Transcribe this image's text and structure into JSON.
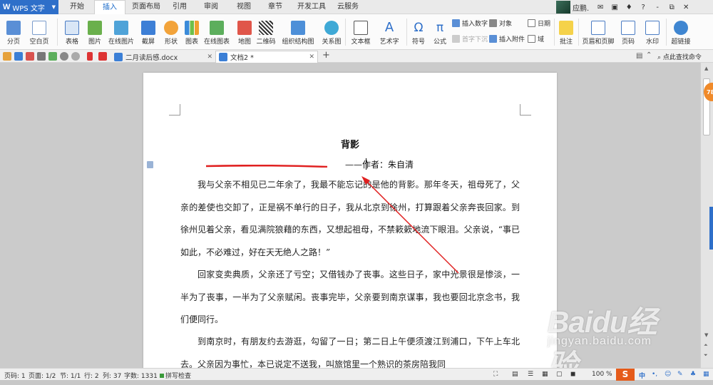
{
  "app": {
    "name": "WPS 文字",
    "logo": "W"
  },
  "ribbon_tabs": [
    {
      "label": "开始"
    },
    {
      "label": "插入"
    },
    {
      "label": "页面布局"
    },
    {
      "label": "引用"
    },
    {
      "label": "审阅"
    },
    {
      "label": "视图"
    },
    {
      "label": "章节"
    },
    {
      "label": "开发工具"
    },
    {
      "label": "云服务"
    }
  ],
  "active_tab": "插入",
  "user": {
    "name": "应鹏."
  },
  "window_controls": [
    "?",
    "-",
    "⧉",
    "✕"
  ],
  "toolbar": {
    "page_break": "分页",
    "blank_page": "空白页",
    "table": "表格",
    "picture": "图片",
    "online_picture": "在线图片",
    "screenshot": "截屏",
    "shape": "形状",
    "chart": "图表",
    "online_chart": "在线图表",
    "map": "地图",
    "qrcode": "二维码",
    "org_chart": "组织结构图",
    "relation_chart": "关系图",
    "textbox": "文本框",
    "wordart": "艺术字",
    "symbol": "符号",
    "formula": "公式",
    "insert_number": "插入数字",
    "object": "对象",
    "date": "日期",
    "drop_cap": "首字下沉",
    "attachment": "插入附件",
    "field": "域",
    "comment": "批注",
    "header_footer": "页眉和页脚",
    "page_number": "页码",
    "watermark": "水印",
    "hyperlink": "超链接"
  },
  "doc_tabs": [
    {
      "label": "二月读后感.docx",
      "active": false
    },
    {
      "label": "文档2 *",
      "active": true
    }
  ],
  "find_command": "点此查找命令",
  "document": {
    "title": "背影",
    "author_line": "——作者：朱自清",
    "paragraphs": [
      "我与父亲不相见已二年余了，我最不能忘记的是他的背影。那年冬天，祖母死了，父亲的差使也交卸了，正是祸不单行的日子，我从北京到徐州，打算跟着父亲奔丧回家。到徐州见着父亲，看见满院狼藉的东西，又想起祖母，不禁簌簌地流下眼泪。父亲说，“事已如此，不必难过，好在天无绝人之路！”",
      "回家变卖典质，父亲还了亏空；又借钱办了丧事。这些日子，家中光景很是惨淡，一半为了丧事，一半为了父亲赋闲。丧事完毕，父亲要到南京谋事，我也要回北京念书，我们便同行。",
      "到南京时，有朋友约去游逛，勾留了一日；第二日上午便须渡江到浦口，下午上车北去。父亲因为事忙，本已说定不送我，叫旅馆里一个熟识的茶房陪我同"
    ]
  },
  "badge": {
    "value": "78"
  },
  "statusbar": {
    "page_code": "页码: 1",
    "page": "页面: 1/2",
    "section": "节: 1/1",
    "row": "行: 2",
    "col": "列: 37",
    "words": "字数: 1331",
    "spell": "拼写检查",
    "zoom": "100 %",
    "ime": "S",
    "ime_mode": "中"
  },
  "watermark": {
    "brand": "Baidu经验",
    "url": "jingyan.baidu.com"
  },
  "colors": {
    "accent": "#2e6fc9",
    "annotation": "#e02020",
    "badge": "#f08a2a"
  }
}
